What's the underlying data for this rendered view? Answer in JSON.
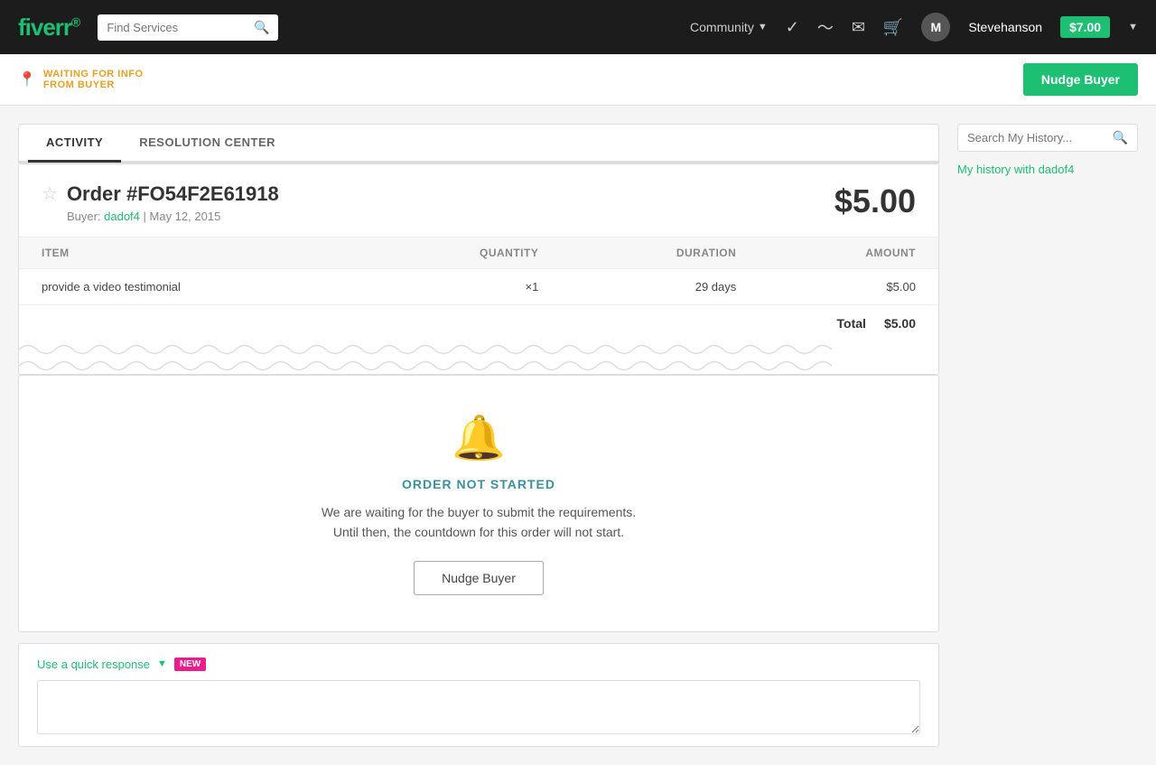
{
  "navbar": {
    "logo": "fiverr",
    "logo_dot": "®",
    "search_placeholder": "Find Services",
    "community_label": "Community",
    "username": "Stevehanson",
    "avatar_initial": "M",
    "balance": "$7.00"
  },
  "status_bar": {
    "label_line1": "WAITING FOR INFO",
    "label_line2": "FROM BUYER",
    "nudge_button": "Nudge Buyer"
  },
  "tabs": [
    {
      "id": "activity",
      "label": "ACTIVITY",
      "active": true
    },
    {
      "id": "resolution",
      "label": "RESOLUTION CENTER",
      "active": false
    }
  ],
  "order": {
    "title": "Order #FO54F2E61918",
    "price": "$5.00",
    "buyer_label": "Buyer:",
    "buyer_name": "dadof4",
    "date": "May 12, 2015",
    "table_headers": [
      "ITEM",
      "QUANTITY",
      "DURATION",
      "AMOUNT"
    ],
    "items": [
      {
        "name": "provide a video testimonial",
        "quantity": "×1",
        "duration": "29 days",
        "amount": "$5.00"
      }
    ],
    "total_label": "Total",
    "total_amount": "$5.00"
  },
  "order_status": {
    "title": "ORDER NOT STARTED",
    "desc_line1": "We are waiting for the buyer to submit the requirements.",
    "desc_line2": "Until then, the countdown for this order will not start.",
    "nudge_button": "Nudge Buyer"
  },
  "quick_response": {
    "link_label": "Use a quick response",
    "new_badge": "NEW",
    "placeholder": ""
  },
  "sidebar": {
    "search_placeholder": "Search My History...",
    "history_link": "My history with dadof4"
  }
}
